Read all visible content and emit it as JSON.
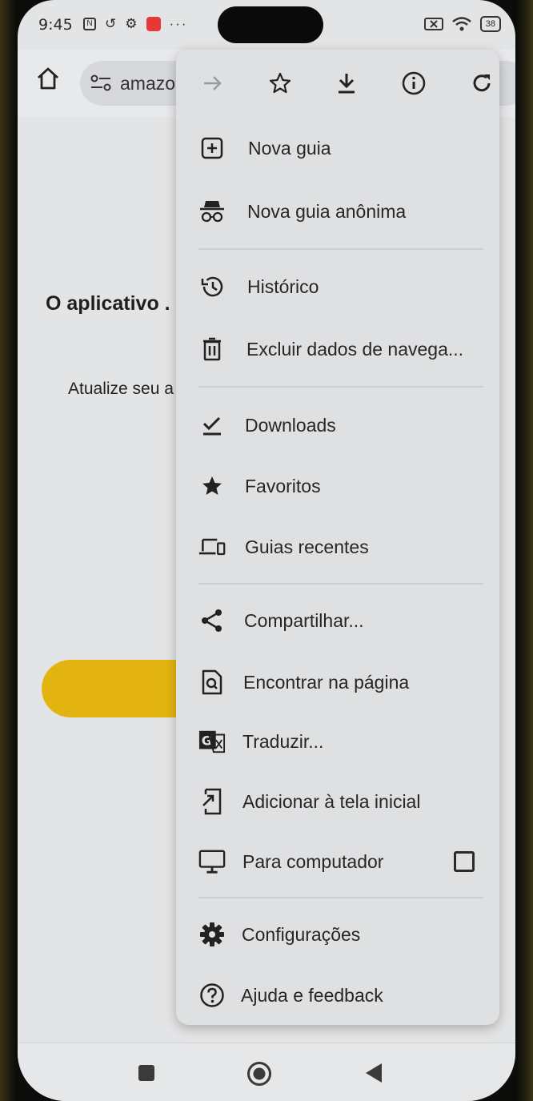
{
  "status_bar": {
    "time": "9:45",
    "battery": "38",
    "more": "···"
  },
  "toolbar": {
    "url": "amazo"
  },
  "page": {
    "heading": "O aplicativo .",
    "body": "Atualize seu a"
  },
  "menu": {
    "items": [
      {
        "label": "Nova guia",
        "icon": "new-tab-icon"
      },
      {
        "label": "Nova guia anônima",
        "icon": "incognito-icon"
      },
      {
        "label": "Histórico",
        "icon": "history-icon"
      },
      {
        "label": "Excluir dados de navega...",
        "icon": "trash-icon"
      },
      {
        "label": "Downloads",
        "icon": "downloads-check-icon"
      },
      {
        "label": "Favoritos",
        "icon": "star-filled-icon"
      },
      {
        "label": "Guias recentes",
        "icon": "devices-icon"
      },
      {
        "label": "Compartilhar...",
        "icon": "share-icon"
      },
      {
        "label": "Encontrar na página",
        "icon": "find-in-page-icon"
      },
      {
        "label": "Traduzir...",
        "icon": "translate-icon"
      },
      {
        "label": "Adicionar à tela inicial",
        "icon": "add-to-home-icon"
      },
      {
        "label": "Para computador",
        "icon": "desktop-icon",
        "checked": false
      },
      {
        "label": "Configurações",
        "icon": "gear-icon"
      },
      {
        "label": "Ajuda e feedback",
        "icon": "help-icon"
      }
    ]
  },
  "colors": {
    "accent_button": "#e3b40f",
    "menu_bg": "#dfe0e2"
  }
}
